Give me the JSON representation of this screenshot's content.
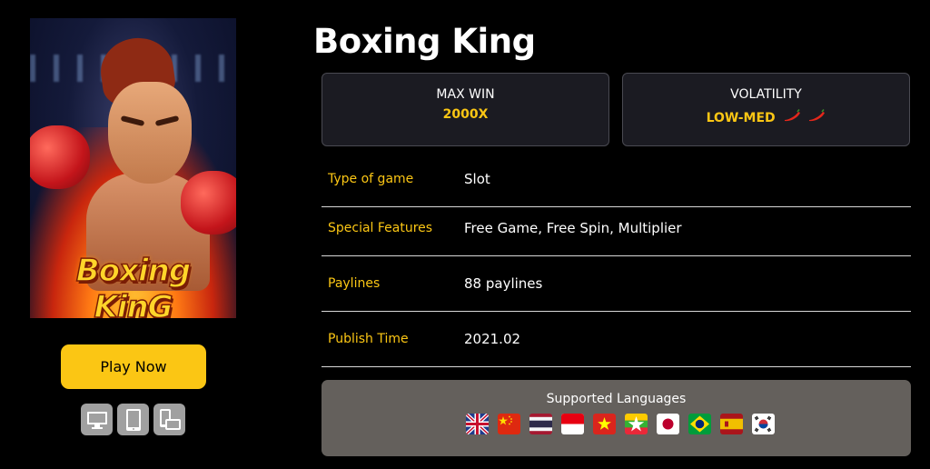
{
  "game": {
    "title": "Boxing King",
    "cover_logo_text": "Boxing KinG",
    "play_button": "Play Now"
  },
  "devices": [
    {
      "icon": "desktop-icon"
    },
    {
      "icon": "tablet-icon"
    },
    {
      "icon": "mobile-rotate-icon"
    }
  ],
  "stats": {
    "max_win": {
      "label": "MAX WIN",
      "value": "2000X"
    },
    "volatility": {
      "label": "VOLATILITY",
      "value": "LOW-MED",
      "chili_count": 2,
      "chili_color": "#e3271b"
    }
  },
  "info": [
    {
      "key": "Type of game",
      "value": "Slot"
    },
    {
      "key": "Special Features",
      "value": "Free Game, Free Spin, Multiplier"
    },
    {
      "key": "Paylines",
      "value": "88 paylines"
    },
    {
      "key": "Publish Time",
      "value": "2021.02"
    }
  ],
  "languages": {
    "heading": "Supported Languages",
    "flags": [
      "uk-flag",
      "china-flag",
      "thailand-flag",
      "indonesia-flag",
      "vietnam-flag",
      "myanmar-flag",
      "japan-flag",
      "brazil-flag",
      "spain-flag",
      "korea-flag"
    ]
  },
  "colors": {
    "accent": "#fbc614",
    "background": "#000000",
    "stat_box": "#1b1b22",
    "languages_panel": "#64605c"
  }
}
